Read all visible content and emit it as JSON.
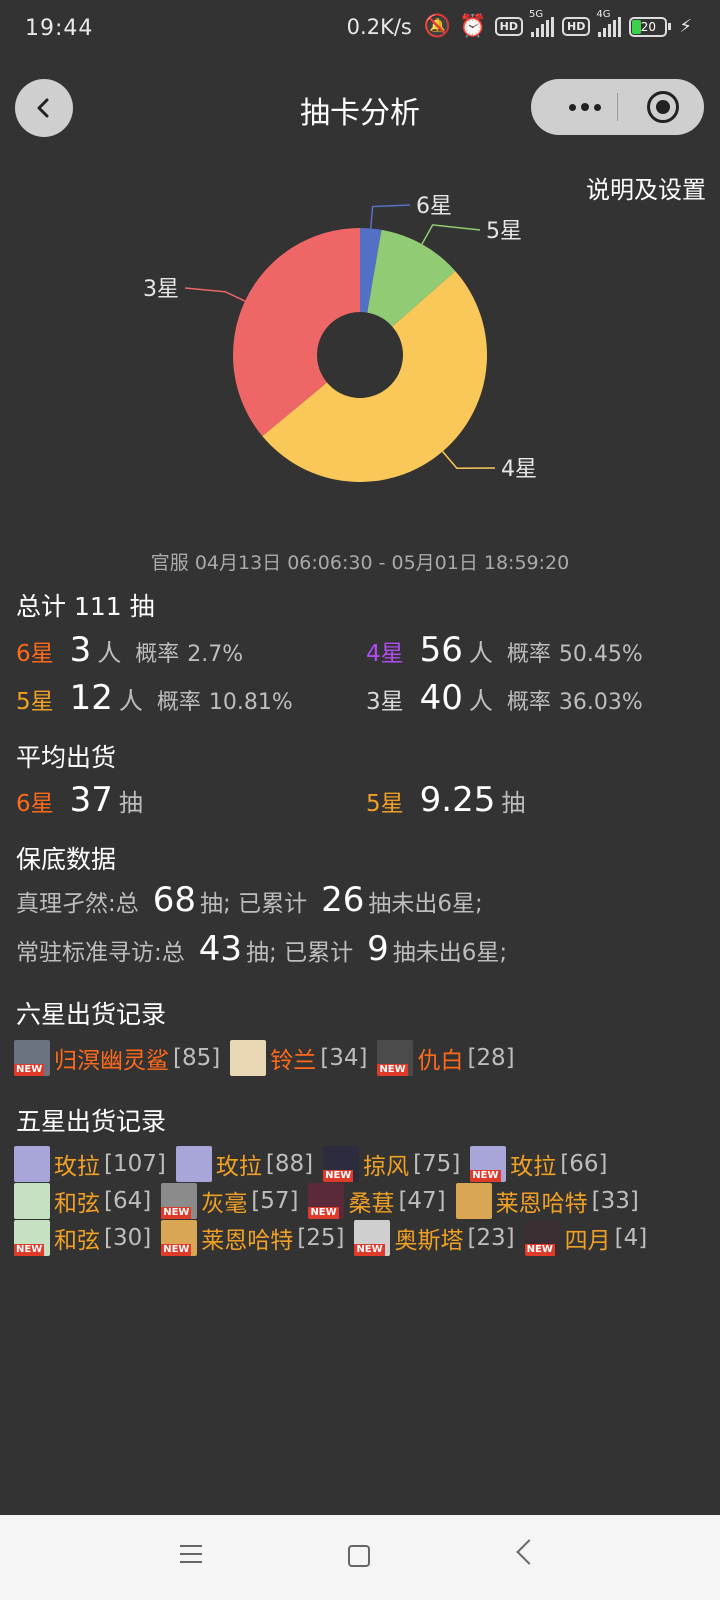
{
  "status_bar": {
    "time": "19:44",
    "net_speed": "0.2K/s",
    "sim1_label": "5G",
    "sim2_label": "4G",
    "battery": "20"
  },
  "header": {
    "title": "抽卡分析",
    "settings_label": "说明及设置"
  },
  "chart_data": {
    "type": "pie",
    "donut": true,
    "categories": [
      "6星",
      "5星",
      "4星",
      "3星"
    ],
    "values": [
      3,
      12,
      56,
      40
    ],
    "colors": [
      "#5470c6",
      "#91cc75",
      "#fac858",
      "#ee6666"
    ],
    "labels": [
      "6星",
      "5星",
      "4星",
      "3星"
    ]
  },
  "range_text": "官服  04月13日 06:06:30  -  05月01日 18:59:20",
  "total": {
    "title": "总计 111 抽",
    "rows": [
      {
        "star": "6星",
        "count": "3",
        "unit": "人",
        "rate_label": "概率",
        "rate": "2.7%"
      },
      {
        "star": "4星",
        "count": "56",
        "unit": "人",
        "rate_label": "概率",
        "rate": "50.45%"
      },
      {
        "star": "5星",
        "count": "12",
        "unit": "人",
        "rate_label": "概率",
        "rate": "10.81%"
      },
      {
        "star": "3星",
        "count": "40",
        "unit": "人",
        "rate_label": "概率",
        "rate": "36.03%"
      }
    ]
  },
  "average": {
    "title": "平均出货",
    "six": {
      "star": "6星",
      "value": "37",
      "unit": "抽"
    },
    "five": {
      "star": "5星",
      "value": "9.25",
      "unit": "抽"
    }
  },
  "pity": {
    "title": "保底数据",
    "rows": [
      {
        "pre": "真理孑然:总",
        "total": "68",
        "mid": "抽;  已累计",
        "acc": "26",
        "post": "抽未出6星;"
      },
      {
        "pre": "常驻标准寻访:总",
        "total": "43",
        "mid": "抽;  已累计",
        "acc": "9",
        "post": "抽未出6星;"
      }
    ]
  },
  "six_records": {
    "title": "六星出货记录",
    "items": [
      {
        "name": "归溟幽灵鲨",
        "count": "[85]",
        "is_new": true,
        "avatar_color": "#6b7280"
      },
      {
        "name": "铃兰",
        "count": "[34]",
        "is_new": false,
        "avatar_color": "#e9d7b5"
      },
      {
        "name": "仇白",
        "count": "[28]",
        "is_new": true,
        "avatar_color": "#4b4b4b"
      }
    ]
  },
  "five_records": {
    "title": "五星出货记录",
    "lines": [
      [
        {
          "name": "玫拉",
          "count": "[107]",
          "is_new": false,
          "avatar_color": "#a8a6d9"
        },
        {
          "name": "玫拉",
          "count": "[88]",
          "is_new": false,
          "avatar_color": "#a8a6d9"
        },
        {
          "name": "掠风",
          "count": "[75]",
          "is_new": true,
          "avatar_color": "#2d2b3e"
        },
        {
          "name": "玫拉",
          "count": "[66]",
          "is_new": true,
          "avatar_color": "#a8a6d9"
        }
      ],
      [
        {
          "name": "和弦",
          "count": "[64]",
          "is_new": false,
          "avatar_color": "#c6e0c2"
        },
        {
          "name": "灰毫",
          "count": "[57]",
          "is_new": true,
          "avatar_color": "#8b8b8b"
        },
        {
          "name": "桑葚",
          "count": "[47]",
          "is_new": true,
          "avatar_color": "#5b2a3a"
        },
        {
          "name": "莱恩哈特",
          "count": "[33]",
          "is_new": false,
          "avatar_color": "#d9a653"
        }
      ],
      [
        {
          "name": "和弦",
          "count": "[30]",
          "is_new": true,
          "avatar_color": "#c6e0c2"
        },
        {
          "name": "莱恩哈特",
          "count": "[25]",
          "is_new": true,
          "avatar_color": "#d9a653"
        },
        {
          "name": "奥斯塔",
          "count": "[23]",
          "is_new": true,
          "avatar_color": "#cfcfcf"
        },
        {
          "name": "四月",
          "count": "[4]",
          "is_new": true,
          "avatar_color": "#3a2e33"
        }
      ]
    ]
  },
  "new_badge": "NEW",
  "icons": {
    "back": "back-arrow-icon",
    "more": "more-dots-icon",
    "close": "target-close-icon",
    "nav_menu": "menu-icon",
    "nav_home": "home-square-icon",
    "nav_back": "back-chevron-icon"
  }
}
